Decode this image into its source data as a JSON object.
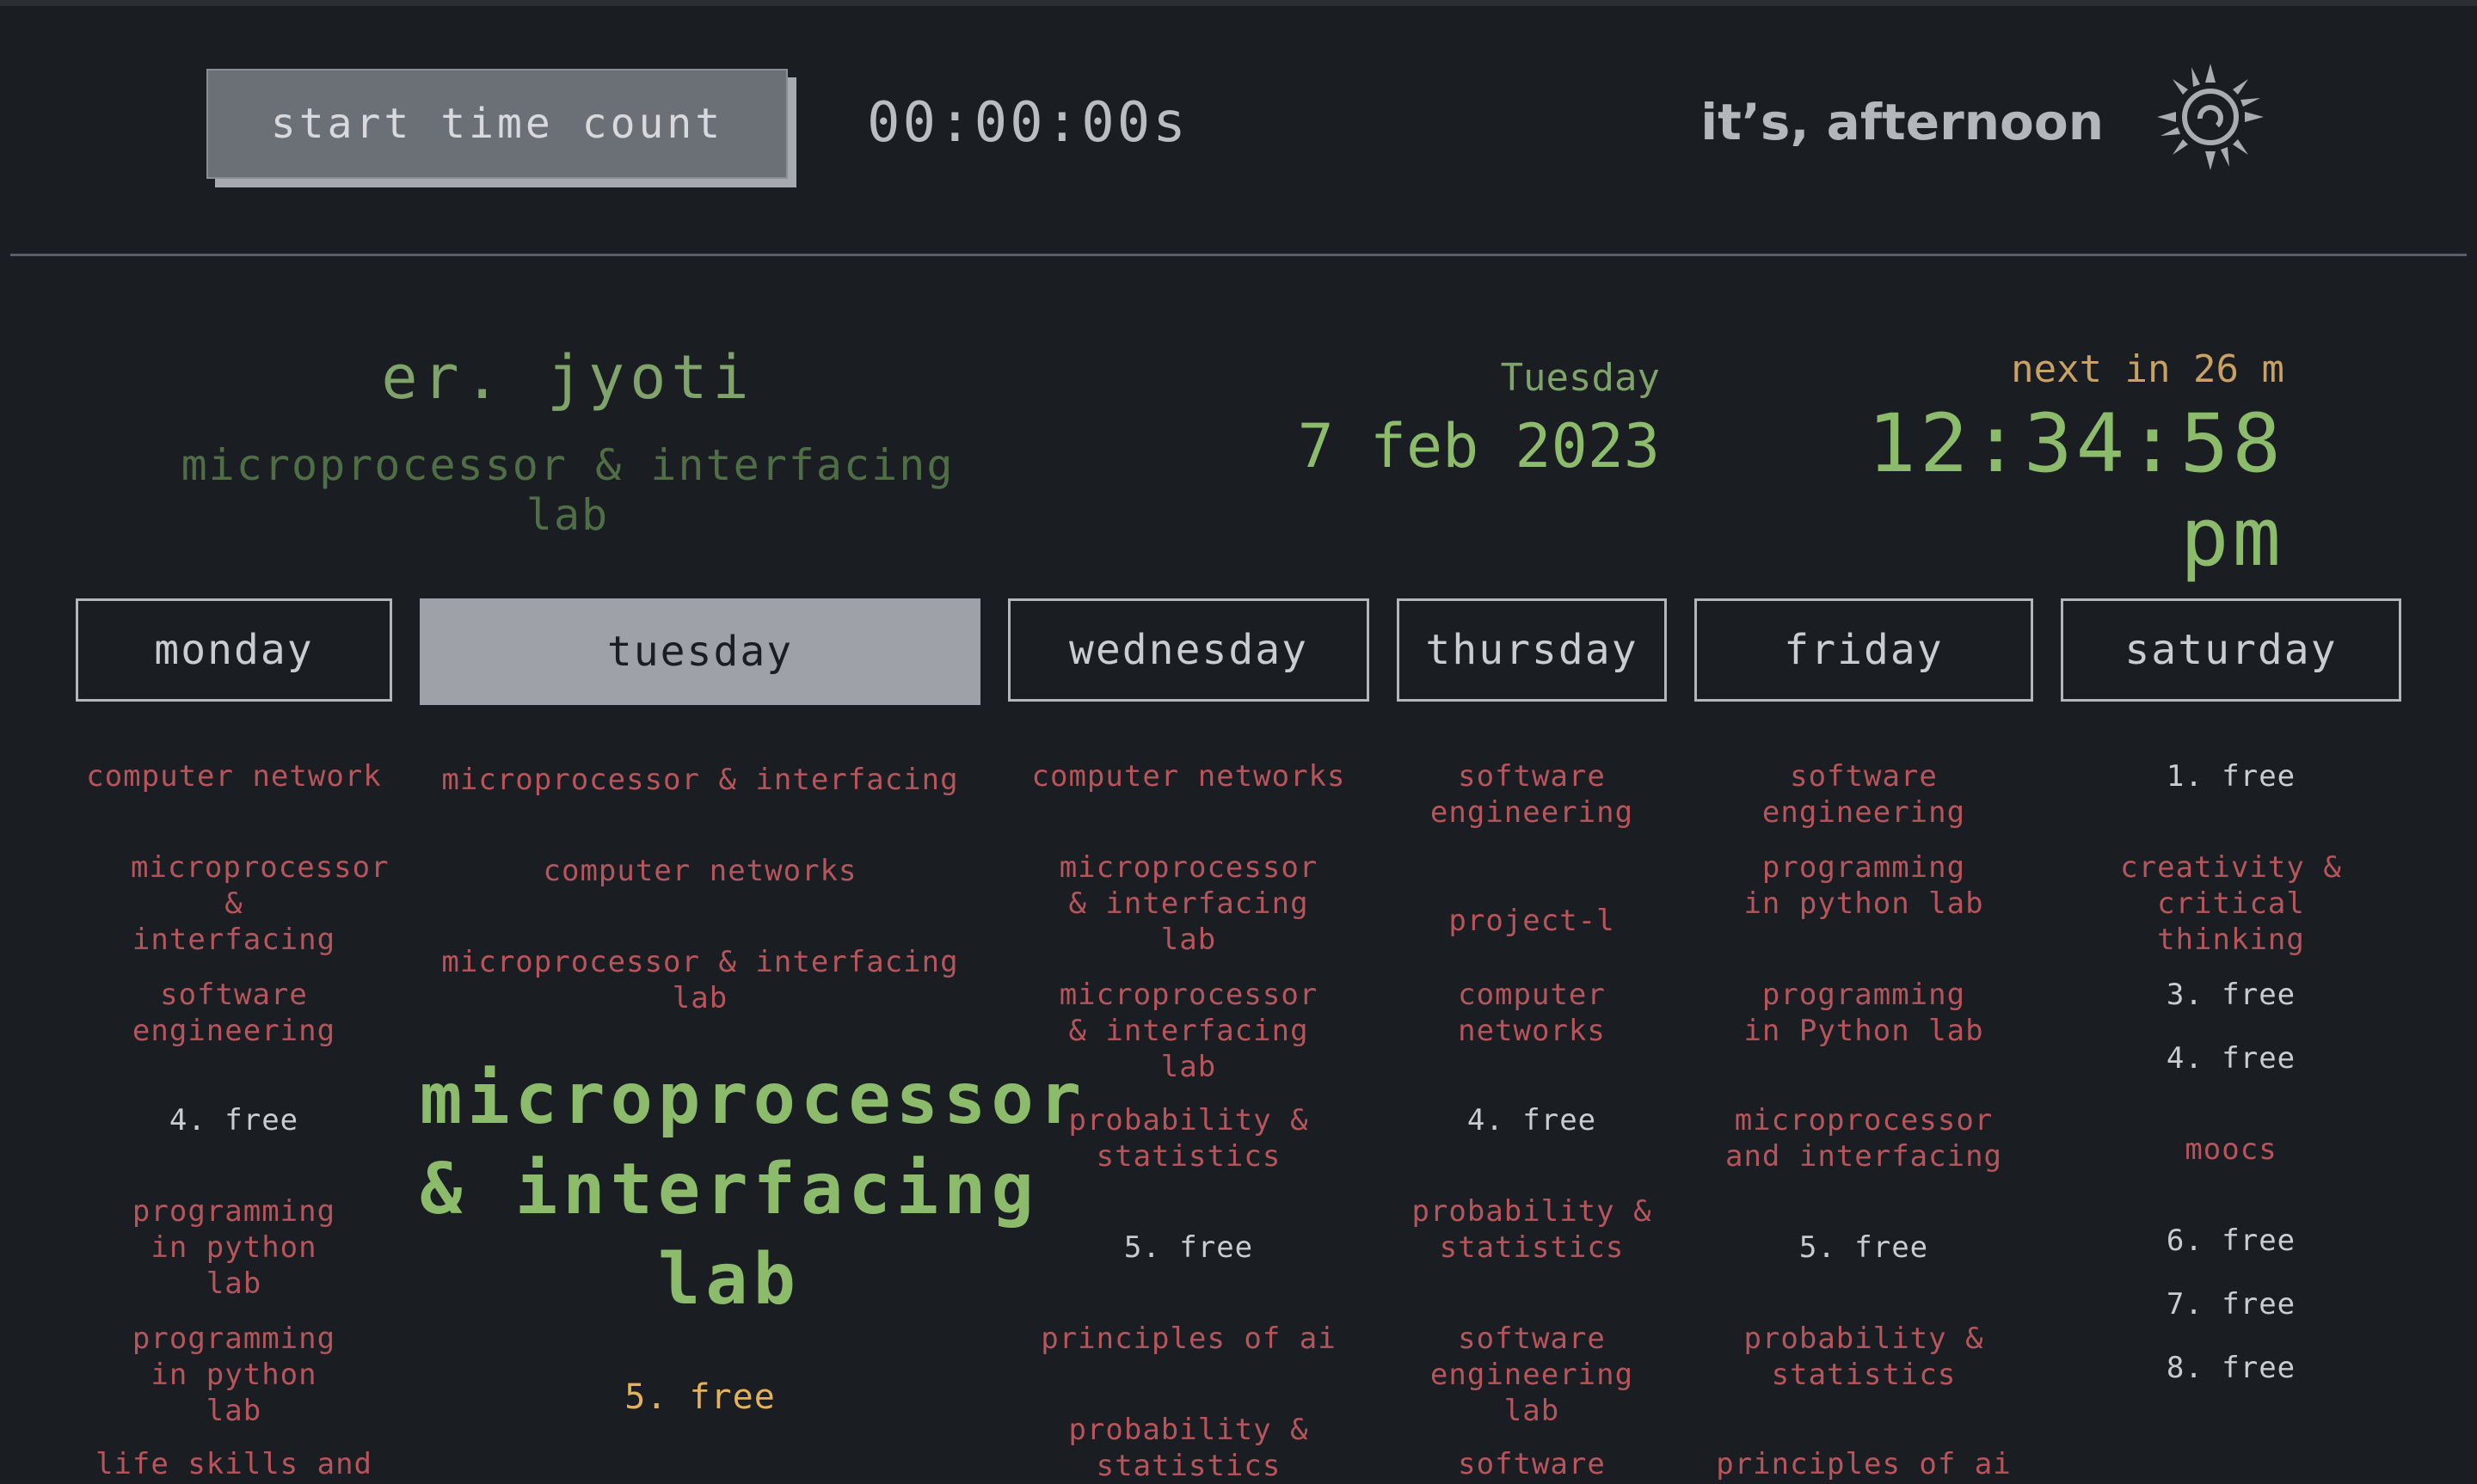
{
  "header": {
    "timer_button": "start time count",
    "timer_value": "00:00:00s",
    "greeting": "it’s, afternoon"
  },
  "info": {
    "teacher": "er. jyoti",
    "subject": "microprocessor & interfacing lab",
    "day": "Tuesday",
    "date": "7 feb 2023",
    "next": "next in 26 m",
    "clock": "12:34:58 pm"
  },
  "colors": {
    "background": "#1a1d21",
    "green": "#8cbb6c",
    "red": "#b6555b",
    "amber": "#c9a163"
  },
  "days": [
    {
      "name": "monday",
      "items": [
        "computer network",
        "microprocessor & interfacing",
        "software engineering",
        "4. free",
        "programming in python lab",
        "programming in python lab",
        "life skills and"
      ]
    },
    {
      "name": "tuesday",
      "active": true,
      "items": [
        "microprocessor & interfacing",
        "computer networks",
        "microprocessor & interfacing lab",
        "microprocessor & interfacing lab",
        "5. free"
      ]
    },
    {
      "name": "wednesday",
      "items": [
        "computer networks",
        "microprocessor & interfacing lab",
        "microprocessor & interfacing lab",
        "probability & statistics",
        "5. free",
        "principles of ai",
        "probability & statistics"
      ]
    },
    {
      "name": "thursday",
      "items": [
        "software engineering",
        "project-l",
        "computer networks",
        "4. free",
        "probability & statistics",
        "software engineering lab",
        "software"
      ]
    },
    {
      "name": "friday",
      "items": [
        "software engineering",
        "programming in python lab",
        "programming in Python lab",
        "microprocessor and interfacing",
        "5. free",
        "probability & statistics",
        "principles of ai"
      ]
    },
    {
      "name": "saturday",
      "items": [
        "1. free",
        "creativity & critical thinking",
        "3. free",
        "4. free",
        "moocs",
        "6. free",
        "7. free",
        "8. free"
      ]
    }
  ]
}
